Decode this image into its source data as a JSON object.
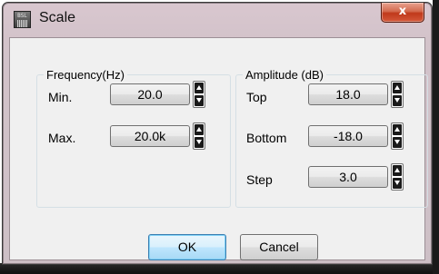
{
  "window": {
    "title": "Scale",
    "icon_text": "BSL",
    "close_symbol": "x"
  },
  "frequency": {
    "legend": "Frequency(Hz)",
    "min_label": "Min.",
    "min_value": "20.0",
    "max_label": "Max.",
    "max_value": "20.0k"
  },
  "amplitude": {
    "legend": "Amplitude (dB)",
    "top_label": "Top",
    "top_value": "18.0",
    "bottom_label": "Bottom",
    "bottom_value": "-18.0",
    "step_label": "Step",
    "step_value": "3.0"
  },
  "buttons": {
    "ok": "OK",
    "cancel": "Cancel"
  }
}
